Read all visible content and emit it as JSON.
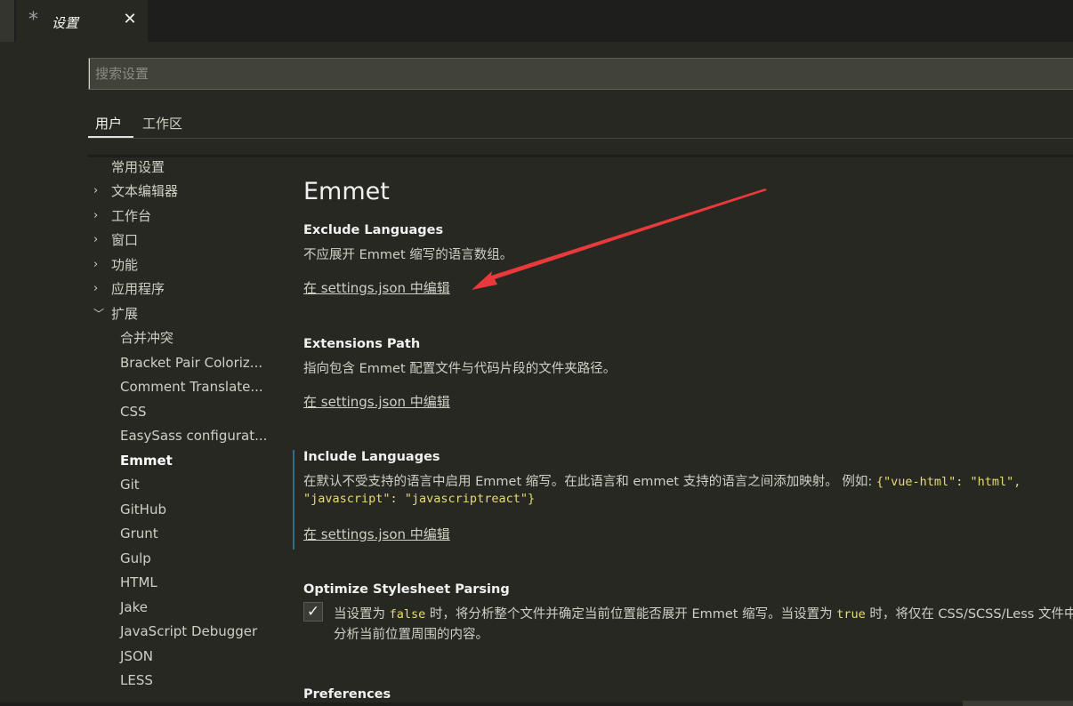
{
  "tab": {
    "icon": "asterisk-icon",
    "title": "设置",
    "close": "✕"
  },
  "search": {
    "placeholder": "搜索设置"
  },
  "scope": {
    "user": "用户",
    "workspace": "工作区"
  },
  "toc": {
    "items": [
      {
        "label": "常用设置",
        "chevron": ""
      },
      {
        "label": "文本编辑器",
        "chevron": ">"
      },
      {
        "label": "工作台",
        "chevron": ">"
      },
      {
        "label": "窗口",
        "chevron": ">"
      },
      {
        "label": "功能",
        "chevron": ">"
      },
      {
        "label": "应用程序",
        "chevron": ">"
      },
      {
        "label": "扩展",
        "chevron": "v"
      }
    ],
    "subitems": [
      "合并冲突",
      "Bracket Pair Coloriz...",
      "Comment Translate...",
      "CSS",
      "EasySass configurat...",
      "Emmet",
      "Git",
      "GitHub",
      "Grunt",
      "Gulp",
      "HTML",
      "Jake",
      "JavaScript Debugger",
      "JSON",
      "LESS"
    ],
    "active": "Emmet"
  },
  "content": {
    "title": "Emmet",
    "settings": {
      "exclude": {
        "name": "Exclude Languages",
        "desc": "不应展开 Emmet 缩写的语言数组。",
        "link": "在 settings.json 中编辑"
      },
      "extensions": {
        "name": "Extensions Path",
        "desc": "指向包含 Emmet 配置文件与代码片段的文件夹路径。",
        "link": "在 settings.json 中编辑"
      },
      "include": {
        "name": "Include Languages",
        "desc": "在默认不受支持的语言中启用 Emmet 缩写。在此语言和 emmet 支持的语言之间添加映射。 例如: ",
        "code1": "{\"vue-html\": \"html\",",
        "code2": "\"javascript\": \"javascriptreact\"}",
        "link": "在 settings.json 中编辑"
      },
      "optimize": {
        "name": "Optimize Stylesheet Parsing",
        "checked": true,
        "desc_a": "当设置为 ",
        "code_false": "false",
        "desc_b": " 时，将分析整个文件并确定当前位置能否展开 Emmet 缩写。当设置为 ",
        "code_true": "true",
        "desc_c": " 时，将仅在 CSS/SCSS/Less 文件中",
        "desc_line2": "分析当前位置周围的内容。"
      },
      "preferences": {
        "name": "Preferences"
      }
    }
  },
  "annotation": {
    "color": "#e83a3a"
  }
}
